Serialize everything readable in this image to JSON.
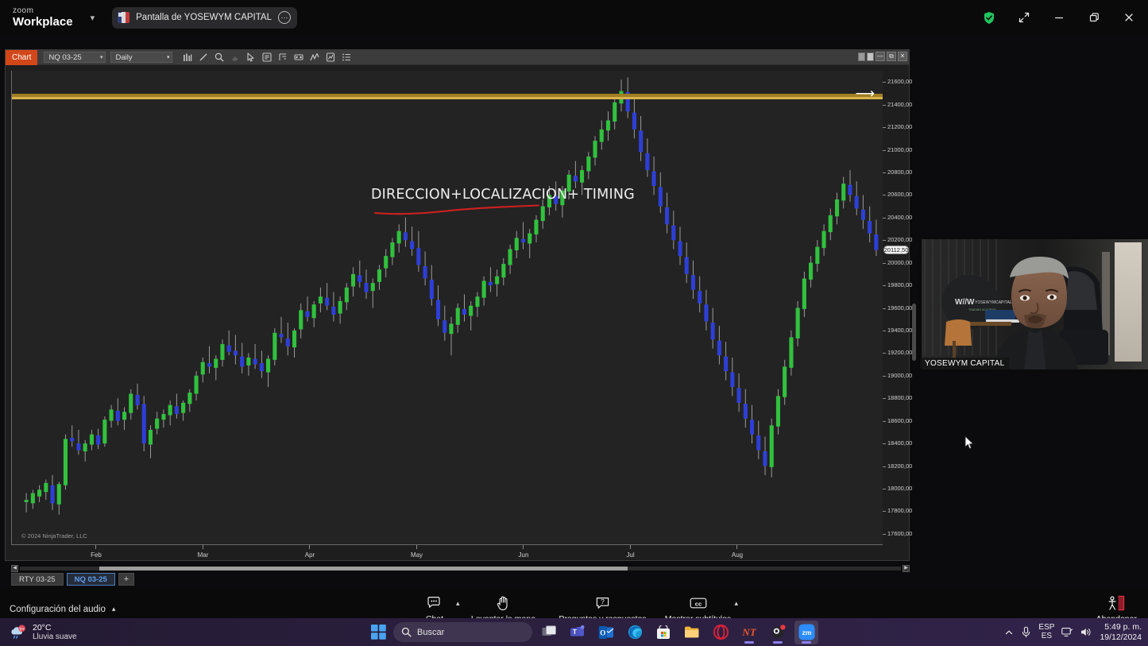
{
  "zoom_app": {
    "brand_line1": "zoom",
    "brand_line2": "Workplace",
    "share_label": "Pantalla de YOSEWYM CAPITAL",
    "share_more_icon": "more-options-icon",
    "caret_icon": "chevron-down-icon",
    "window_controls": {
      "shield_icon": "security-shield-icon",
      "expand_icon": "fullscreen-expand-icon",
      "minimize_icon": "minimize-icon",
      "restore_icon": "restore-icon",
      "close_icon": "close-icon"
    }
  },
  "ninjatrader": {
    "chart_button": "Chart",
    "instrument": "NQ 03-25",
    "interval": "Daily",
    "toolbar_icons": [
      "bar-chart-icon",
      "pencil-icon",
      "magnifier-icon",
      "eraser-icon",
      "pointer-icon",
      "data-box-icon",
      "order-flow-icon",
      "binoculars-icon",
      "indicator-line-icon",
      "properties-icon",
      "list-icon"
    ],
    "window_buttons": [
      "restore-down-icon",
      "maximize-icon",
      "minimize-icon",
      "restore-icon",
      "close-icon"
    ],
    "arrow_icon": "arrow-right-icon",
    "annotation": "DIRECCION+LOCALIZACION+ TIMING",
    "copyright": "© 2024 NinjaTrader, LLC",
    "current_price": "20112,50",
    "tabs": [
      {
        "label": "RTY 03-25",
        "active": false
      },
      {
        "label": "NQ 03-25",
        "active": true
      }
    ],
    "add_tab_label": "+"
  },
  "chart_data": {
    "type": "line",
    "title": "NQ 03-25 Daily",
    "xlabel": "",
    "ylabel": "",
    "grid": false,
    "legend": "none",
    "ylim": [
      17500,
      21700
    ],
    "ytick_labels": [
      "21600,00",
      "21400,00",
      "21200,00",
      "21000,00",
      "20800,00",
      "20600,00",
      "20400,00",
      "20200,00",
      "20000,00",
      "19800,00",
      "19600,00",
      "19400,00",
      "19200,00",
      "19000,00",
      "18800,00",
      "18600,00",
      "18400,00",
      "18200,00",
      "18000,00",
      "17800,00",
      "17600,00"
    ],
    "ytick_values": [
      21600,
      21400,
      21200,
      21000,
      20800,
      20600,
      20400,
      20200,
      20000,
      19800,
      19600,
      19400,
      19200,
      19000,
      18800,
      18600,
      18400,
      18200,
      18000,
      17800,
      17600
    ],
    "xtick_labels": [
      "Feb",
      "Mar",
      "Apr",
      "May",
      "Jun",
      "Jul",
      "Aug"
    ],
    "annotations": [
      {
        "text": "DIRECCION+LOCALIZACION+ TIMING",
        "color": "#efefef"
      },
      {
        "text": "gold horizontal line",
        "value": 21430,
        "color": "#d8b24a"
      },
      {
        "text": "current price marker",
        "value": 20112.5,
        "color": "#f3f3f3"
      }
    ],
    "candle_up_color": "#31c13e",
    "candle_down_color": "#2d3fd6",
    "wick_color": "#9a9a9a",
    "series": [
      {
        "name": "NQ 03-25 OHLC (daily)",
        "ohlc": [
          [
            17880,
            17960,
            17790,
            17900
          ],
          [
            17870,
            17990,
            17820,
            17960
          ],
          [
            17930,
            18030,
            17880,
            17990
          ],
          [
            17970,
            18080,
            17900,
            18050
          ],
          [
            18030,
            18120,
            17810,
            17870
          ],
          [
            17860,
            18060,
            17770,
            18040
          ],
          [
            18030,
            18480,
            17990,
            18440
          ],
          [
            18450,
            18560,
            18370,
            18420
          ],
          [
            18400,
            18520,
            18300,
            18340
          ],
          [
            18330,
            18430,
            18240,
            18400
          ],
          [
            18390,
            18520,
            18340,
            18480
          ],
          [
            18470,
            18530,
            18350,
            18390
          ],
          [
            18400,
            18640,
            18370,
            18610
          ],
          [
            18600,
            18740,
            18540,
            18700
          ],
          [
            18690,
            18800,
            18560,
            18600
          ],
          [
            18610,
            18720,
            18520,
            18680
          ],
          [
            18670,
            18880,
            18610,
            18840
          ],
          [
            18830,
            18930,
            18700,
            18740
          ],
          [
            18750,
            18820,
            18330,
            18400
          ],
          [
            18390,
            18560,
            18270,
            18520
          ],
          [
            18530,
            18680,
            18480,
            18620
          ],
          [
            18610,
            18700,
            18540,
            18660
          ],
          [
            18650,
            18780,
            18560,
            18740
          ],
          [
            18730,
            18840,
            18620,
            18660
          ],
          [
            18670,
            18780,
            18600,
            18760
          ],
          [
            18750,
            18880,
            18680,
            18850
          ],
          [
            18840,
            19040,
            18780,
            19000
          ],
          [
            19010,
            19160,
            18940,
            19120
          ],
          [
            19110,
            19260,
            19020,
            19080
          ],
          [
            19070,
            19180,
            18960,
            19150
          ],
          [
            19140,
            19320,
            19080,
            19280
          ],
          [
            19270,
            19400,
            19180,
            19210
          ],
          [
            19220,
            19360,
            19100,
            19180
          ],
          [
            19170,
            19290,
            19020,
            19080
          ],
          [
            19090,
            19200,
            19000,
            19160
          ],
          [
            19150,
            19280,
            19060,
            19100
          ],
          [
            19110,
            19220,
            18980,
            19040
          ],
          [
            19030,
            19180,
            18900,
            19150
          ],
          [
            19140,
            19420,
            19090,
            19380
          ],
          [
            19370,
            19520,
            19290,
            19340
          ],
          [
            19330,
            19470,
            19180,
            19260
          ],
          [
            19250,
            19420,
            19160,
            19400
          ],
          [
            19410,
            19640,
            19330,
            19580
          ],
          [
            19570,
            19700,
            19480,
            19520
          ],
          [
            19510,
            19660,
            19430,
            19630
          ],
          [
            19640,
            19780,
            19560,
            19700
          ],
          [
            19690,
            19820,
            19580,
            19620
          ],
          [
            19610,
            19740,
            19480,
            19540
          ],
          [
            19550,
            19700,
            19460,
            19660
          ],
          [
            19650,
            19820,
            19580,
            19780
          ],
          [
            19790,
            19960,
            19700,
            19900
          ],
          [
            19890,
            20020,
            19780,
            19830
          ],
          [
            19820,
            19940,
            19680,
            19740
          ],
          [
            19750,
            19860,
            19600,
            19820
          ],
          [
            19830,
            19980,
            19760,
            19940
          ],
          [
            19950,
            20120,
            19870,
            20060
          ],
          [
            20050,
            20220,
            19980,
            20180
          ],
          [
            20170,
            20340,
            20090,
            20280
          ],
          [
            20270,
            20400,
            20140,
            20200
          ],
          [
            20190,
            20320,
            20060,
            20120
          ],
          [
            20130,
            20280,
            19920,
            19980
          ],
          [
            19970,
            20100,
            19800,
            19860
          ],
          [
            19850,
            19980,
            19620,
            19680
          ],
          [
            19670,
            19800,
            19440,
            19500
          ],
          [
            19490,
            19620,
            19310,
            19380
          ],
          [
            19370,
            19520,
            19180,
            19460
          ],
          [
            19450,
            19640,
            19380,
            19600
          ],
          [
            19590,
            19720,
            19480,
            19540
          ],
          [
            19530,
            19660,
            19400,
            19620
          ],
          [
            19610,
            19740,
            19520,
            19700
          ],
          [
            19690,
            19880,
            19620,
            19840
          ],
          [
            19830,
            19960,
            19740,
            19800
          ],
          [
            19810,
            19940,
            19700,
            19880
          ],
          [
            19870,
            20040,
            19800,
            19990
          ],
          [
            19980,
            20160,
            19900,
            20120
          ],
          [
            20110,
            20280,
            20040,
            20220
          ],
          [
            20210,
            20360,
            20120,
            20180
          ],
          [
            20170,
            20300,
            20040,
            20260
          ],
          [
            20250,
            20420,
            20180,
            20380
          ],
          [
            20370,
            20560,
            20300,
            20500
          ],
          [
            20490,
            20680,
            20420,
            20600
          ],
          [
            20590,
            20720,
            20460,
            20520
          ],
          [
            20510,
            20680,
            20400,
            20640
          ],
          [
            20630,
            20820,
            20560,
            20780
          ],
          [
            20770,
            20900,
            20660,
            20720
          ],
          [
            20710,
            20860,
            20600,
            20820
          ],
          [
            20810,
            20980,
            20740,
            20940
          ],
          [
            20930,
            21120,
            20860,
            21080
          ],
          [
            21070,
            21260,
            21000,
            21180
          ],
          [
            21170,
            21340,
            21080,
            21260
          ],
          [
            21250,
            21480,
            21180,
            21420
          ],
          [
            21410,
            21620,
            21340,
            21520
          ],
          [
            21510,
            21640,
            21280,
            21340
          ],
          [
            21330,
            21460,
            21100,
            21180
          ],
          [
            21170,
            21300,
            20900,
            20980
          ],
          [
            20970,
            21100,
            20760,
            20820
          ],
          [
            20810,
            20940,
            20600,
            20680
          ],
          [
            20670,
            20800,
            20440,
            20500
          ],
          [
            20490,
            20620,
            20260,
            20340
          ],
          [
            20330,
            20460,
            20120,
            20200
          ],
          [
            20190,
            20320,
            19980,
            20060
          ],
          [
            20050,
            20180,
            19820,
            19900
          ],
          [
            19890,
            20020,
            19680,
            19760
          ],
          [
            19750,
            19880,
            19560,
            19640
          ],
          [
            19630,
            19760,
            19400,
            19480
          ],
          [
            19470,
            19600,
            19240,
            19320
          ],
          [
            19310,
            19440,
            19100,
            19180
          ],
          [
            19170,
            19300,
            18960,
            19040
          ],
          [
            19030,
            19160,
            18820,
            18900
          ],
          [
            18890,
            19020,
            18680,
            18760
          ],
          [
            18750,
            18880,
            18540,
            18620
          ],
          [
            18610,
            18740,
            18400,
            18480
          ],
          [
            18470,
            18600,
            18260,
            18340
          ],
          [
            18330,
            18460,
            18120,
            18200
          ],
          [
            18190,
            18620,
            18100,
            18560
          ],
          [
            18550,
            18880,
            18480,
            18820
          ],
          [
            18810,
            19140,
            18740,
            19080
          ],
          [
            19070,
            19400,
            19000,
            19340
          ],
          [
            19330,
            19660,
            19260,
            19600
          ],
          [
            19590,
            19920,
            19520,
            19860
          ],
          [
            19850,
            20060,
            19780,
            20000
          ],
          [
            19990,
            20200,
            19920,
            20140
          ],
          [
            20130,
            20340,
            20060,
            20280
          ],
          [
            20270,
            20480,
            20200,
            20420
          ],
          [
            20410,
            20620,
            20340,
            20560
          ],
          [
            20550,
            20760,
            20480,
            20700
          ],
          [
            20690,
            20820,
            20540,
            20600
          ],
          [
            20590,
            20720,
            20420,
            20480
          ],
          [
            20470,
            20600,
            20300,
            20380
          ],
          [
            20370,
            20500,
            20180,
            20260
          ],
          [
            20250,
            20380,
            20060,
            20112.5
          ]
        ]
      }
    ]
  },
  "video": {
    "participant_name": "YOSEWYM CAPITAL",
    "logo_text": "WM | YOSEWYMCAPITAL"
  },
  "zoom_toolbar": {
    "audio_settings": "Configuración del audio",
    "audio_caret_icon": "chevron-up-icon",
    "items": [
      {
        "label": "Chat",
        "icon": "chat-bubble-icon",
        "caret": true
      },
      {
        "label": "Levantar la mano",
        "icon": "raise-hand-icon",
        "caret": false
      },
      {
        "label": "Preguntas y respuestas",
        "icon": "question-box-icon",
        "caret": false
      },
      {
        "label": "Mostrar subtítulos",
        "icon": "closed-caption-icon",
        "caret": true
      }
    ],
    "leave": {
      "label": "Abandonar",
      "icon": "leave-meeting-icon"
    }
  },
  "taskbar": {
    "weather": {
      "temp": "20°C",
      "condition": "Lluvia suave",
      "badge": "9+"
    },
    "start_icon": "windows-start-icon",
    "search_placeholder": "Buscar",
    "search_icon": "search-icon",
    "apps": [
      {
        "name": "task-view-icon",
        "label": "Task View"
      },
      {
        "name": "teams-icon",
        "label": "Microsoft Teams"
      },
      {
        "name": "outlook-icon",
        "label": "Outlook"
      },
      {
        "name": "edge-icon",
        "label": "Microsoft Edge"
      },
      {
        "name": "microsoft-store-icon",
        "label": "Microsoft Store"
      },
      {
        "name": "file-explorer-icon",
        "label": "Explorador de archivos"
      },
      {
        "name": "opera-icon",
        "label": "Opera"
      },
      {
        "name": "ninjatrader-icon",
        "label": "NinjaTrader"
      },
      {
        "name": "obs-studio-icon",
        "label": "OBS Studio"
      },
      {
        "name": "zoom-icon",
        "label": "Zoom"
      }
    ],
    "tray": {
      "overflow_icon": "chevron-up-icon",
      "mic_icon": "microphone-icon",
      "lang_line1": "ESP",
      "lang_line2": "ES",
      "network_icon": "network-icon",
      "volume_icon": "speaker-icon",
      "time": "5:49 p. m.",
      "date": "19/12/2024"
    }
  }
}
